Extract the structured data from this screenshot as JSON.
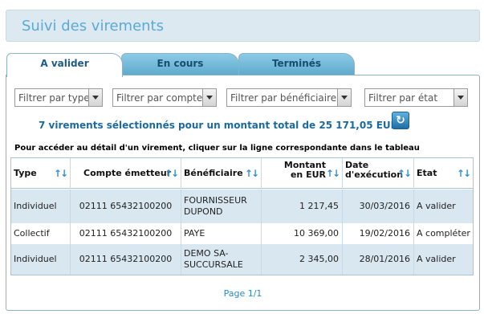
{
  "header": {
    "title": "Suivi des virements"
  },
  "tabs": [
    {
      "label": "A valider",
      "active": true
    },
    {
      "label": "En cours",
      "active": false
    },
    {
      "label": "Terminés",
      "active": false
    }
  ],
  "filters": {
    "type": "Filtrer par type",
    "account": "Filtrer par compte",
    "beneficiary": "Filtrer par bénéficiaire",
    "status": "Filtrer par état"
  },
  "summary": "7 virements sélectionnés pour un montant total de 25 171,05 EUR",
  "hint": "Pour accéder au détail d'un virement, cliquer sur la ligne correspondante dans le tableau",
  "table": {
    "columns": {
      "type": "Type",
      "account": "Compte émetteur",
      "beneficiary": "Bénéficiaire",
      "amount": "Montant en EUR",
      "date": "Date d'exécution",
      "status": "Etat"
    },
    "rows": [
      {
        "type": "Individuel",
        "account": "02111 65432100200",
        "beneficiary": "FOURNISSEUR DUPOND",
        "amount": "1 217,45",
        "date": "30/03/2016",
        "status": "A valider"
      },
      {
        "type": "Collectif",
        "account": "02111 65432100200",
        "beneficiary": "PAYE",
        "amount": "10 369,00",
        "date": "19/02/2016",
        "status": "A compléter"
      },
      {
        "type": "Individuel",
        "account": "02111 65432100200",
        "beneficiary": "DEMO SA-SUCCURSALE",
        "amount": "2 345,00",
        "date": "28/01/2016",
        "status": "A valider"
      }
    ]
  },
  "pager": "Page 1/1",
  "colors": {
    "accent": "#5aa9d6",
    "tab": "#5ea9cc",
    "row_alt": "#d9e7f1"
  }
}
